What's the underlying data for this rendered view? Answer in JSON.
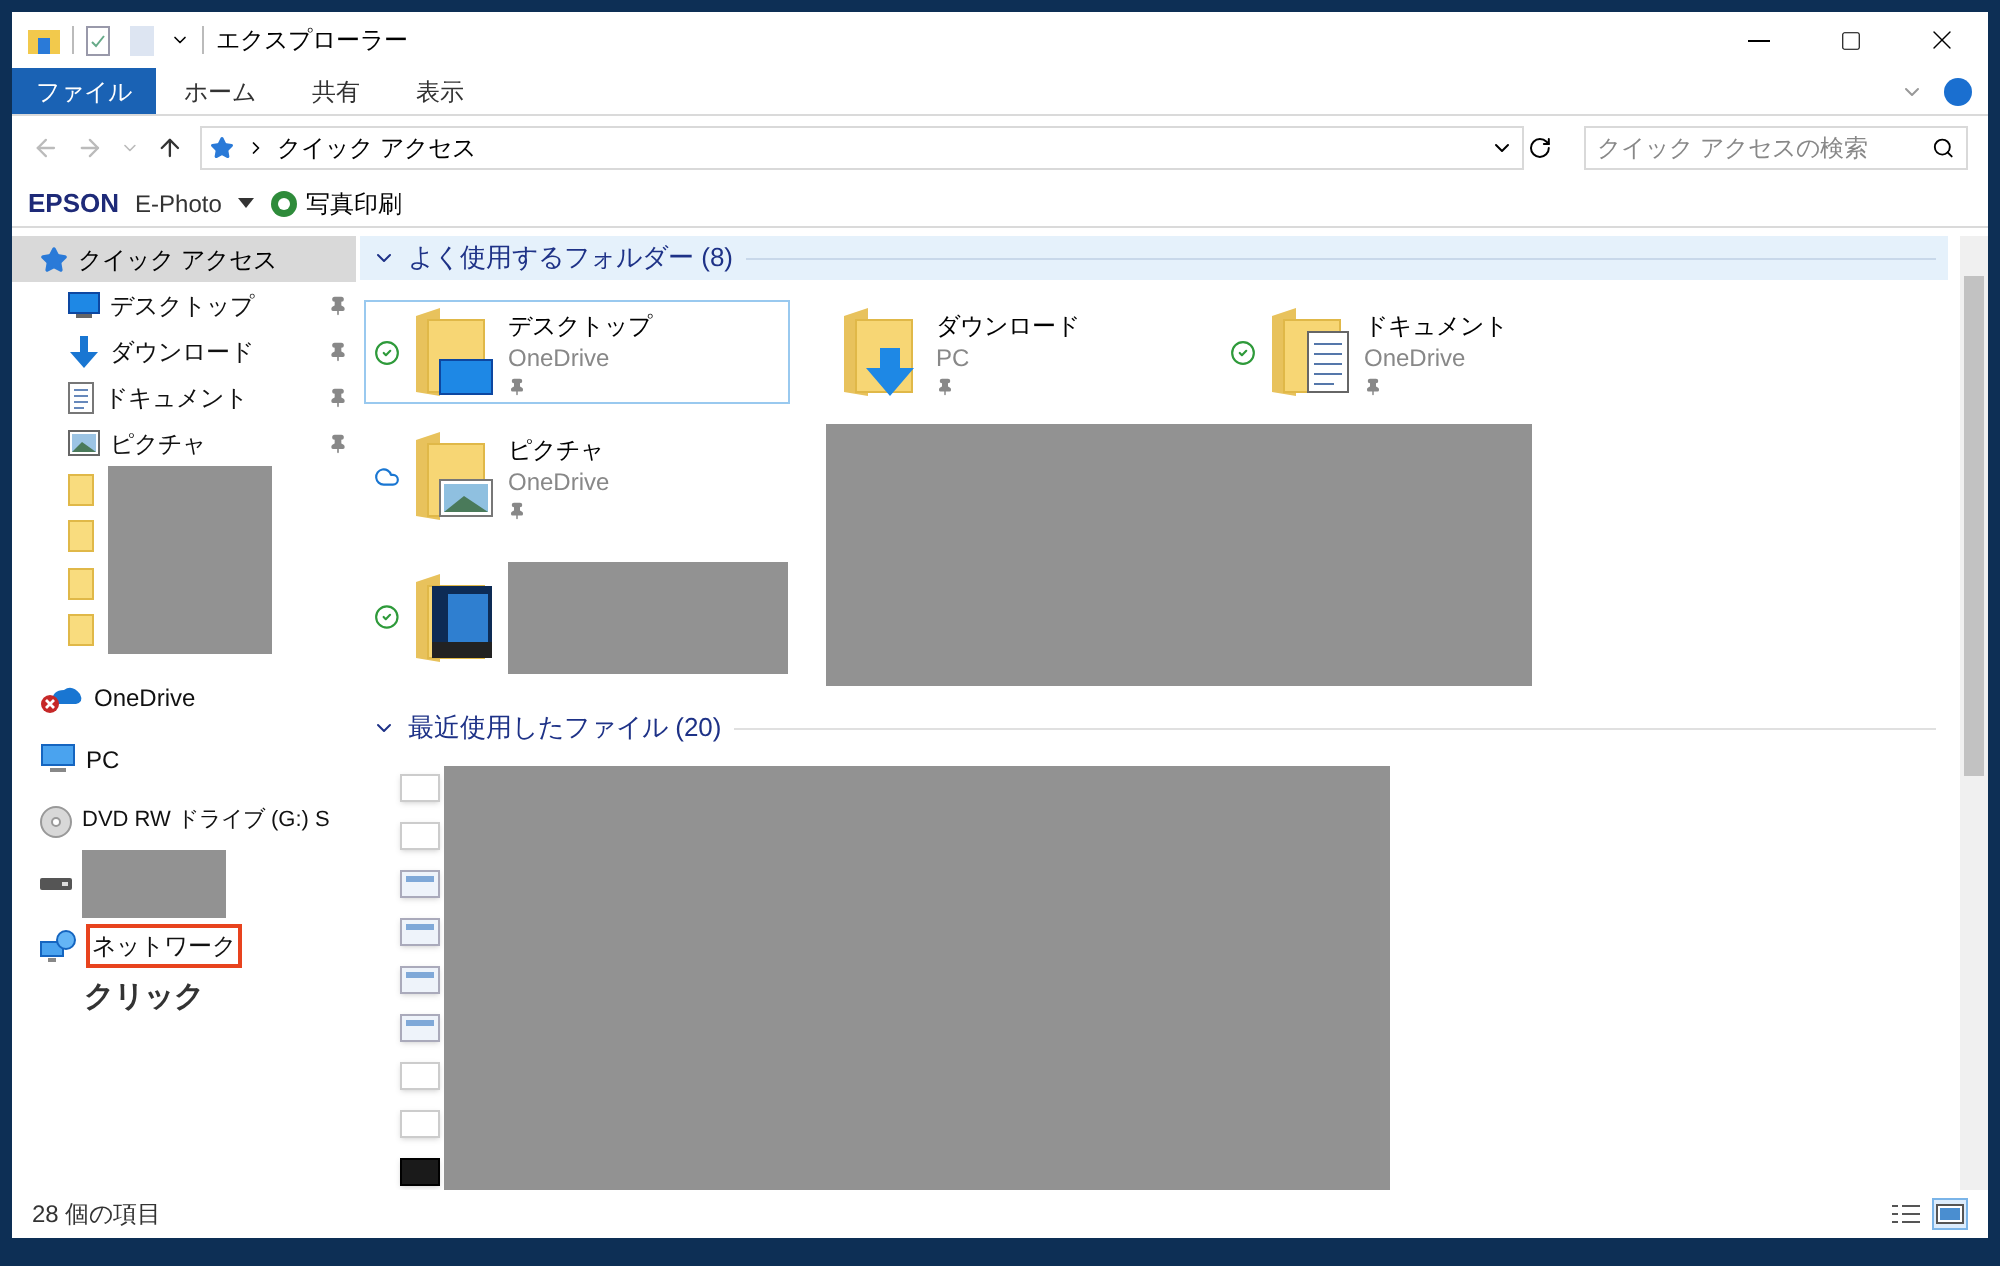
{
  "window": {
    "title": "エクスプローラー"
  },
  "ribbon_tabs": [
    {
      "label": "ファイル",
      "selected": true
    },
    {
      "label": "ホーム",
      "selected": false
    },
    {
      "label": "共有",
      "selected": false
    },
    {
      "label": "表示",
      "selected": false
    }
  ],
  "address_bar": {
    "path": "クイック アクセス"
  },
  "search": {
    "placeholder": "クイック アクセスの検索"
  },
  "toolbar": {
    "brand": "EPSON",
    "app": "E-Photo",
    "action": "写真印刷"
  },
  "sidebar": {
    "items": [
      {
        "label": "クイック アクセス",
        "kind": "quick",
        "selected": true,
        "pinned": false
      },
      {
        "label": "デスクトップ",
        "kind": "desktop",
        "selected": false,
        "pinned": true
      },
      {
        "label": "ダウンロード",
        "kind": "download",
        "selected": false,
        "pinned": true
      },
      {
        "label": "ドキュメント",
        "kind": "document",
        "selected": false,
        "pinned": true
      },
      {
        "label": "ピクチャ",
        "kind": "pictures",
        "selected": false,
        "pinned": true
      },
      {
        "kind": "masked_folder",
        "selected": false,
        "pinned": false
      },
      {
        "kind": "masked_folder",
        "selected": false,
        "pinned": false
      },
      {
        "kind": "masked_folder",
        "selected": false,
        "pinned": false
      },
      {
        "kind": "masked_folder",
        "selected": false,
        "pinned": false
      },
      {
        "label": "OneDrive",
        "kind": "onedrive",
        "selected": false,
        "pinned": false
      },
      {
        "label": "PC",
        "kind": "pc",
        "selected": false,
        "pinned": false
      },
      {
        "label": "DVD RW ドライブ (G:) S",
        "kind": "dvd",
        "selected": false,
        "pinned": false
      },
      {
        "kind": "masked_drive",
        "selected": false,
        "pinned": false
      },
      {
        "label": "ネットワーク",
        "kind": "network",
        "selected": false,
        "pinned": false,
        "highlighted": true
      }
    ],
    "annotation": "クリック"
  },
  "frequent": {
    "title": "よく使用するフォルダー (8)",
    "tiles": [
      {
        "name": "デスクトップ",
        "location": "OneDrive",
        "synced": true,
        "cloud_only": false,
        "kind": "desktop",
        "selected": true,
        "masked": false
      },
      {
        "name": "ダウンロード",
        "location": "PC",
        "synced": false,
        "cloud_only": false,
        "kind": "download",
        "selected": false,
        "masked": false
      },
      {
        "name": "ドキュメント",
        "location": "OneDrive",
        "synced": true,
        "cloud_only": false,
        "kind": "document",
        "selected": false,
        "masked": false
      },
      {
        "name": "ピクチャ",
        "location": "OneDrive",
        "synced": false,
        "cloud_only": true,
        "kind": "pictures",
        "selected": false,
        "masked": false
      },
      {
        "synced": true,
        "cloud_only": false,
        "kind": "windows",
        "selected": false,
        "masked": true
      }
    ]
  },
  "recent": {
    "title": "最近使用したファイル (20)",
    "files": [
      {
        "kind": "blank"
      },
      {
        "kind": "blank"
      },
      {
        "kind": "screenshot"
      },
      {
        "kind": "screenshot"
      },
      {
        "kind": "screenshot"
      },
      {
        "kind": "screenshot"
      },
      {
        "kind": "blank"
      },
      {
        "kind": "blank"
      },
      {
        "kind": "dark"
      }
    ]
  },
  "status_bar": {
    "count": "28 個の項目",
    "views": [
      {
        "kind": "details",
        "selected": false
      },
      {
        "kind": "large_icons",
        "selected": true
      }
    ]
  }
}
